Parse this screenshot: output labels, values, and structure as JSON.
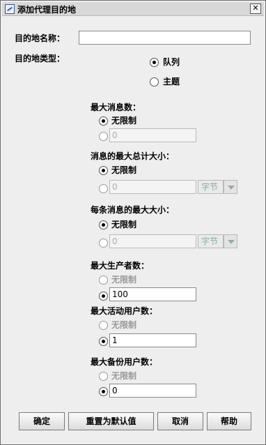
{
  "window": {
    "title": "添加代理目的地",
    "close_glyph": "✕"
  },
  "destination": {
    "name_label": "目的地名称：",
    "name_value": "",
    "type_label": "目的地类型：",
    "type_options": [
      {
        "label": "队列",
        "selected": true
      },
      {
        "label": "主题",
        "selected": false
      }
    ]
  },
  "max_messages": {
    "label": "最大消息数：",
    "unlimited_label": "无限制",
    "unlimited_selected": true,
    "value": "0"
  },
  "max_total_size": {
    "label": "消息的最大总计大小：",
    "unlimited_label": "无限制",
    "unlimited_selected": true,
    "value": "0",
    "unit": "字节"
  },
  "max_message_size": {
    "label": "每条消息的最大大小：",
    "unlimited_label": "无限制",
    "unlimited_selected": true,
    "value": "0",
    "unit": "字节"
  },
  "max_producers": {
    "label": "最大生产者数：",
    "unlimited_label": "无限制",
    "unlimited_selected": false,
    "value": "100"
  },
  "max_active_consumers": {
    "label": "最大活动用户数：",
    "unlimited_label": "无限制",
    "unlimited_selected": false,
    "value": "1"
  },
  "max_backup_consumers": {
    "label": "最大备份用户数：",
    "unlimited_label": "无限制",
    "unlimited_selected": false,
    "value": "0"
  },
  "buttons": {
    "ok": "确定",
    "reset": "重置为默认值",
    "cancel": "取消",
    "help": "帮助"
  }
}
